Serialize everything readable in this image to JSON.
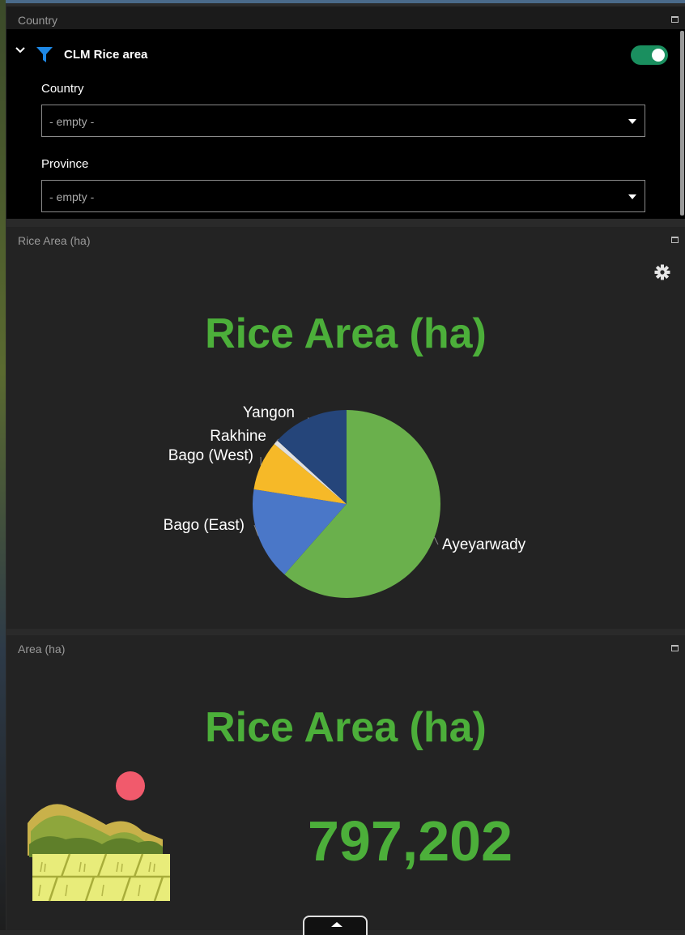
{
  "filter_panel": {
    "title": "Country",
    "layer_name": "CLM Rice area",
    "layer_enabled": true,
    "fields": [
      {
        "label": "Country",
        "value": "- empty -"
      },
      {
        "label": "Province",
        "value": "- empty -"
      }
    ]
  },
  "chart_panel": {
    "title": "Rice Area (ha)"
  },
  "chart_data": {
    "type": "pie",
    "title": "Rice Area (ha)",
    "slices": [
      {
        "label": "Ayeyarwady",
        "value": 61.5,
        "color": "#6ab04c"
      },
      {
        "label": "Bago (East)",
        "value": 16.0,
        "color": "#4a77c8"
      },
      {
        "label": "Bago (West)",
        "value": 8.5,
        "color": "#f6b928"
      },
      {
        "label": "Rakhine",
        "value": 0.8,
        "color": "#e0e0e0"
      },
      {
        "label": "Yangon",
        "value": 13.2,
        "color": "#25457a"
      }
    ],
    "unit_note": "values are approximate percent shares read from slice angles"
  },
  "indicator_panel": {
    "title": "Area (ha)",
    "heading": "Rice Area (ha)",
    "value": "797,202"
  },
  "colors": {
    "accent_green": "#4caf3a",
    "toggle_on": "#1a8f5f",
    "filter_icon": "#1e88e5",
    "sun": "#f15a6c"
  },
  "icons": [
    "chevron-down-icon",
    "filter-icon",
    "maximize-icon",
    "gear-icon",
    "rice-field-illustration",
    "expand-up-icon"
  ]
}
